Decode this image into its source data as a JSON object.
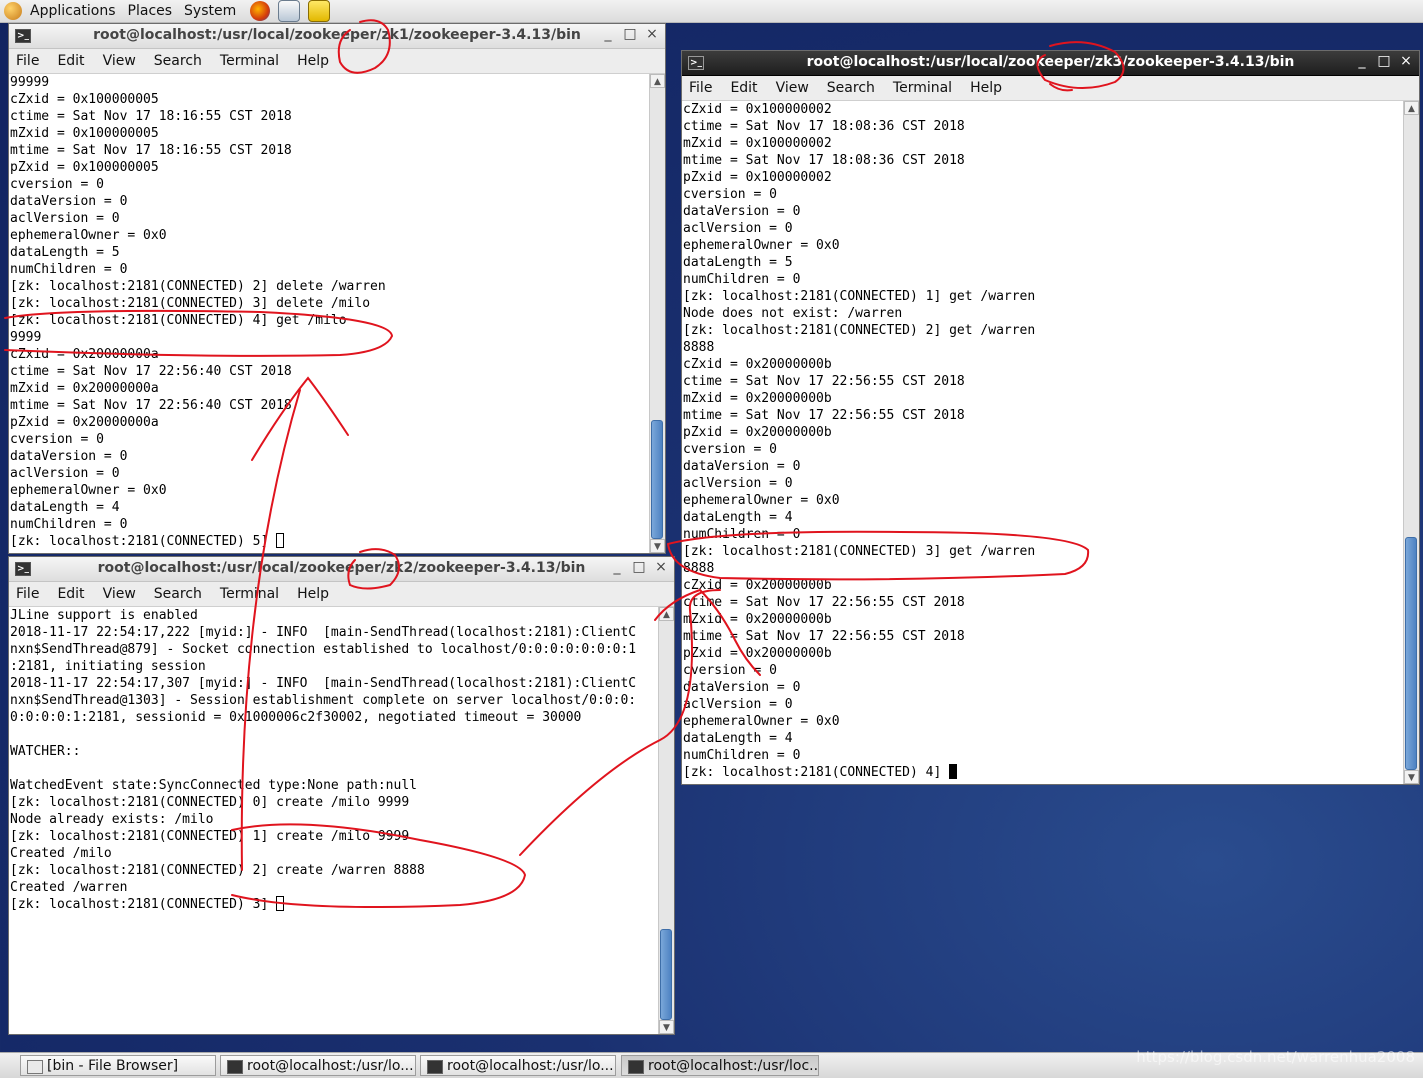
{
  "topbar": {
    "applications": "Applications",
    "places": "Places",
    "system": "System",
    "launchers": [
      "firefox-icon",
      "mail-icon",
      "notes-icon"
    ]
  },
  "menu": [
    "File",
    "Edit",
    "View",
    "Search",
    "Terminal",
    "Help"
  ],
  "windows": {
    "zk1": {
      "title": "root@localhost:/usr/local/zookeeper/zk1/zookeeper-3.4.13/bin",
      "lines": [
        "99999",
        "cZxid = 0x100000005",
        "ctime = Sat Nov 17 18:16:55 CST 2018",
        "mZxid = 0x100000005",
        "mtime = Sat Nov 17 18:16:55 CST 2018",
        "pZxid = 0x100000005",
        "cversion = 0",
        "dataVersion = 0",
        "aclVersion = 0",
        "ephemeralOwner = 0x0",
        "dataLength = 5",
        "numChildren = 0",
        "[zk: localhost:2181(CONNECTED) 2] delete /warren",
        "[zk: localhost:2181(CONNECTED) 3] delete /milo",
        "[zk: localhost:2181(CONNECTED) 4] get /milo",
        "9999",
        "cZxid = 0x20000000a",
        "ctime = Sat Nov 17 22:56:40 CST 2018",
        "mZxid = 0x20000000a",
        "mtime = Sat Nov 17 22:56:40 CST 2018",
        "pZxid = 0x20000000a",
        "cversion = 0",
        "dataVersion = 0",
        "aclVersion = 0",
        "ephemeralOwner = 0x0",
        "dataLength = 4",
        "numChildren = 0"
      ],
      "prompt": "[zk: localhost:2181(CONNECTED) 5] "
    },
    "zk2": {
      "title": "root@localhost:/usr/local/zookeeper/zk2/zookeeper-3.4.13/bin",
      "lines": [
        "JLine support is enabled",
        "2018-11-17 22:54:17,222 [myid:] - INFO  [main-SendThread(localhost:2181):ClientC",
        "nxn$SendThread@879] - Socket connection established to localhost/0:0:0:0:0:0:0:1",
        ":2181, initiating session",
        "2018-11-17 22:54:17,307 [myid:] - INFO  [main-SendThread(localhost:2181):ClientC",
        "nxn$SendThread@1303] - Session establishment complete on server localhost/0:0:0:",
        "0:0:0:0:1:2181, sessionid = 0x1000006c2f30002, negotiated timeout = 30000",
        "",
        "WATCHER::",
        "",
        "WatchedEvent state:SyncConnected type:None path:null",
        "[zk: localhost:2181(CONNECTED) 0] create /milo 9999",
        "Node already exists: /milo",
        "[zk: localhost:2181(CONNECTED) 1] create /milo 9999",
        "Created /milo",
        "[zk: localhost:2181(CONNECTED) 2] create /warren 8888",
        "Created /warren"
      ],
      "prompt": "[zk: localhost:2181(CONNECTED) 3] "
    },
    "zk3": {
      "title": "root@localhost:/usr/local/zookeeper/zk3/zookeeper-3.4.13/bin",
      "lines": [
        "cZxid = 0x100000002",
        "ctime = Sat Nov 17 18:08:36 CST 2018",
        "mZxid = 0x100000002",
        "mtime = Sat Nov 17 18:08:36 CST 2018",
        "pZxid = 0x100000002",
        "cversion = 0",
        "dataVersion = 0",
        "aclVersion = 0",
        "ephemeralOwner = 0x0",
        "dataLength = 5",
        "numChildren = 0",
        "[zk: localhost:2181(CONNECTED) 1] get /warren",
        "Node does not exist: /warren",
        "[zk: localhost:2181(CONNECTED) 2] get /warren",
        "8888",
        "cZxid = 0x20000000b",
        "ctime = Sat Nov 17 22:56:55 CST 2018",
        "mZxid = 0x20000000b",
        "mtime = Sat Nov 17 22:56:55 CST 2018",
        "pZxid = 0x20000000b",
        "cversion = 0",
        "dataVersion = 0",
        "aclVersion = 0",
        "ephemeralOwner = 0x0",
        "dataLength = 4",
        "numChildren = 0",
        "[zk: localhost:2181(CONNECTED) 3] get /warren",
        "8888",
        "cZxid = 0x20000000b",
        "ctime = Sat Nov 17 22:56:55 CST 2018",
        "mZxid = 0x20000000b",
        "mtime = Sat Nov 17 22:56:55 CST 2018",
        "pZxid = 0x20000000b",
        "cversion = 0",
        "dataVersion = 0",
        "aclVersion = 0",
        "ephemeralOwner = 0x0",
        "dataLength = 4",
        "numChildren = 0"
      ],
      "prompt": "[zk: localhost:2181(CONNECTED) 4] "
    }
  },
  "taskbar": {
    "items": [
      "[bin - File Browser]",
      "root@localhost:/usr/lo...",
      "root@localhost:/usr/lo...",
      "root@localhost:/usr/loc..."
    ]
  },
  "watermark": "https://blog.csdn.net/warrenhua2008",
  "colors": {
    "annotation": "#e0141e",
    "desktop": "#1a3070",
    "scroll_thumb": "#4e82c2"
  }
}
